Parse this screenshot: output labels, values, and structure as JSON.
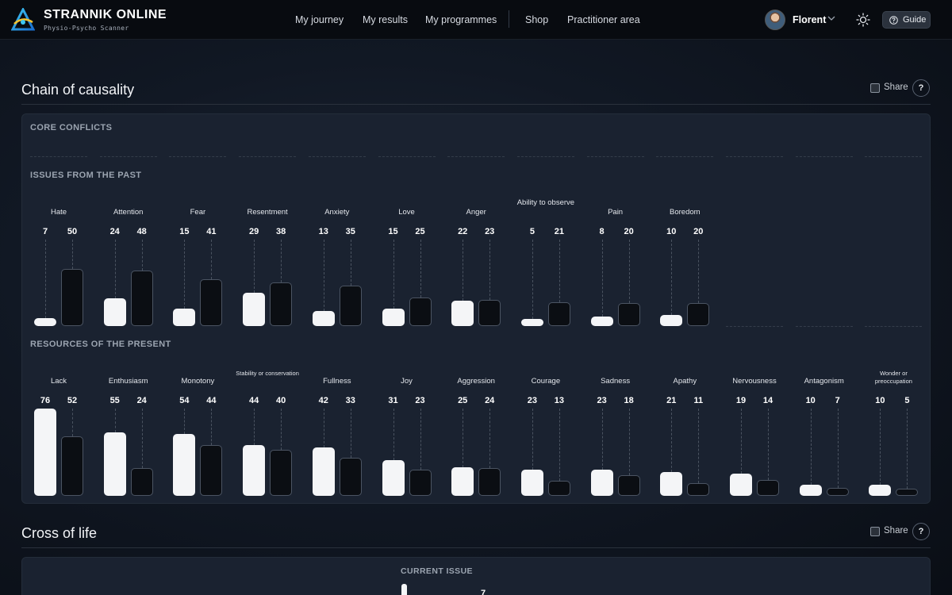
{
  "app": {
    "brand": "STRANNIK ONLINE",
    "tagline": "Physio-Psycho Scanner"
  },
  "nav": [
    "My journey",
    "My results",
    "My programmes",
    "Shop",
    "Practitioner area"
  ],
  "user": {
    "name": "Florent"
  },
  "guide_label": "Guide",
  "colors": {
    "past": "#f4f5f7",
    "present": "#0b0e13",
    "panel": "#1a2230",
    "header": "#080b10"
  },
  "icons": [
    "brand-logo-icon",
    "chevron-down-icon",
    "sun-icon",
    "help-circle-icon"
  ],
  "chain": {
    "title": "Chain of causality",
    "share_label": "Share",
    "help_label": "?",
    "core_conflicts_label": "CORE CONFLICTS",
    "issues_label": "ISSUES FROM THE PAST",
    "resources_label": "RESOURCES OF THE PRESENT",
    "issues": [
      {
        "label": "Hate",
        "a": "7",
        "b": "50"
      },
      {
        "label": "Attention",
        "a": "24",
        "b": "48"
      },
      {
        "label": "Fear",
        "a": "15",
        "b": "41"
      },
      {
        "label": "Resentment",
        "a": "29",
        "b": "38"
      },
      {
        "label": "Anxiety",
        "a": "13",
        "b": "35"
      },
      {
        "label": "Love",
        "a": "15",
        "b": "25"
      },
      {
        "label": "Anger",
        "a": "22",
        "b": "23"
      },
      {
        "label": "Ability to observe",
        "a": "5",
        "b": "21"
      },
      {
        "label": "Pain",
        "a": "8",
        "b": "20"
      },
      {
        "label": "Boredom",
        "a": "10",
        "b": "20"
      }
    ],
    "resources": [
      {
        "label": "Lack",
        "a": "76",
        "b": "52"
      },
      {
        "label": "Enthusiasm",
        "a": "55",
        "b": "24"
      },
      {
        "label": "Monotony",
        "a": "54",
        "b": "44"
      },
      {
        "label": "Stability or conservation",
        "a": "44",
        "b": "40"
      },
      {
        "label": "Fullness",
        "a": "42",
        "b": "33"
      },
      {
        "label": "Joy",
        "a": "31",
        "b": "23"
      },
      {
        "label": "Aggression",
        "a": "25",
        "b": "24"
      },
      {
        "label": "Courage",
        "a": "23",
        "b": "13"
      },
      {
        "label": "Sadness",
        "a": "23",
        "b": "18"
      },
      {
        "label": "Apathy",
        "a": "21",
        "b": "11"
      },
      {
        "label": "Nervousness",
        "a": "19",
        "b": "14"
      },
      {
        "label": "Antagonism",
        "a": "10",
        "b": "7"
      },
      {
        "label": "Wonder or preoccupation",
        "a": "10",
        "b": "5"
      }
    ]
  },
  "cross": {
    "title": "Cross of life",
    "share_label": "Share",
    "help_label": "?",
    "current_issue_label": "CURRENT ISSUE",
    "partial_value": "7"
  }
}
